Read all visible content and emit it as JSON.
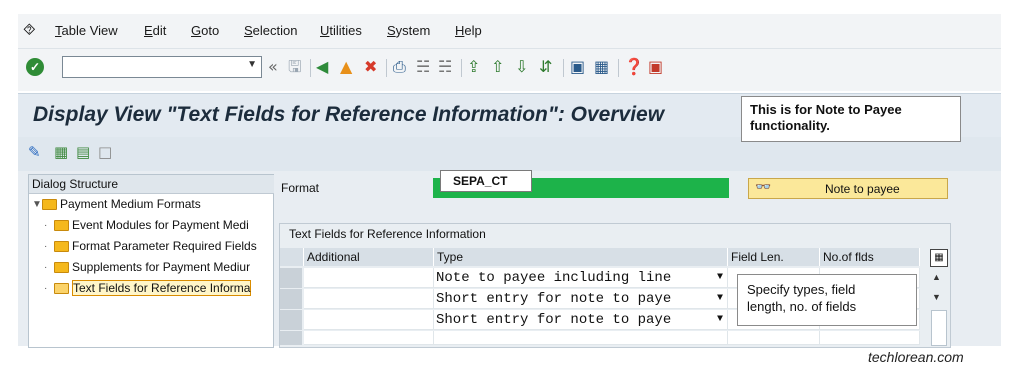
{
  "menu": {
    "items": [
      {
        "u": "T",
        "rest": "able View"
      },
      {
        "u": "E",
        "rest": "dit"
      },
      {
        "u": "G",
        "rest": "oto"
      },
      {
        "u": "S",
        "rest": "election"
      },
      {
        "u": "U",
        "rest": "tilities"
      },
      {
        "u": "S",
        "rest": "ystem"
      },
      {
        "u": "H",
        "rest": "elp"
      }
    ]
  },
  "toolbar": {
    "command_value": ""
  },
  "title": "Display View \"Text Fields for Reference Information\": Overview",
  "notes": {
    "top": "This is for Note to Payee functionality.",
    "table_line1": "Specify types, field",
    "table_line2": "length, no. of fields"
  },
  "dialog": {
    "header": "Dialog Structure",
    "root": "Payment Medium Formats",
    "items": [
      "Event Modules for Payment Medi",
      "Format Parameter Required Fields",
      "Supplements for Payment Mediur",
      "Text Fields for Reference Informa"
    ]
  },
  "format": {
    "label": "Format",
    "value": "SEPA_CT",
    "button_label": "Note to payee"
  },
  "table": {
    "title": "Text Fields for Reference Information",
    "headers": [
      "Additional",
      "Type",
      "Field Len.",
      "No.of flds"
    ],
    "rows": [
      {
        "type": "Note to payee including line"
      },
      {
        "type": "Short entry for note to paye"
      },
      {
        "type": "Short entry for note to paye"
      },
      {
        "type": ""
      }
    ]
  },
  "brand": "techlorean.com",
  "colors": {
    "format_field": "#1db34a",
    "button_bg": "#fbe89a",
    "title_bg": "#e3eaf1"
  }
}
